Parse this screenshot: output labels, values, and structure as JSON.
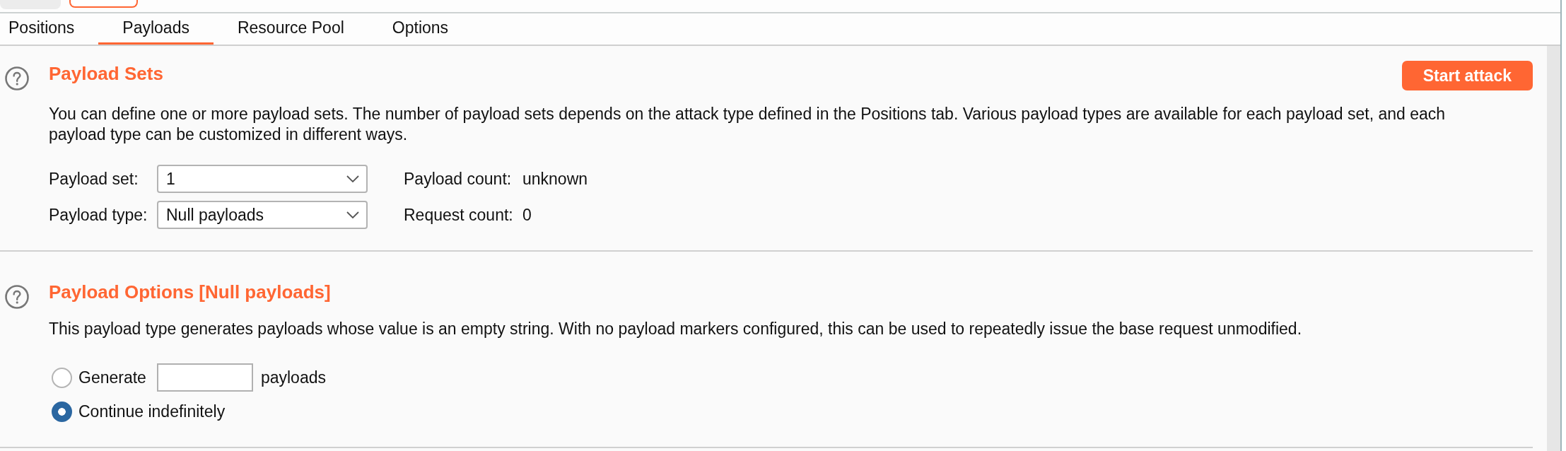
{
  "outer_tabs": [
    {
      "selected": false
    },
    {
      "selected": true
    }
  ],
  "tabs": [
    {
      "label": "Positions",
      "selected": false
    },
    {
      "label": "Payloads",
      "selected": true
    },
    {
      "label": "Resource Pool",
      "selected": false
    },
    {
      "label": "Options",
      "selected": false
    }
  ],
  "payload_sets": {
    "title": "Payload Sets",
    "start_button": "Start attack",
    "description": "You can define one or more payload sets. The number of payload sets depends on the attack type defined in the Positions tab. Various payload types are available for each payload set, and each payload type can be customized in different ways.",
    "fields": [
      {
        "label": "Payload set:",
        "value": "1",
        "info_label": "Payload count:",
        "info_value": "unknown"
      },
      {
        "label": "Payload type:",
        "value": "Null payloads",
        "info_label": "Request count:",
        "info_value": "0"
      }
    ]
  },
  "payload_options": {
    "title": "Payload Options [Null payloads]",
    "description": "This payload type generates payloads whose value is an empty string. With no payload markers configured, this can be used to repeatedly issue the base request unmodified.",
    "options": [
      {
        "kind": "count",
        "label": "Generate",
        "suffix": "payloads",
        "selected": false
      },
      {
        "kind": "plain",
        "label": "Continue indefinitely",
        "selected": true
      }
    ]
  }
}
